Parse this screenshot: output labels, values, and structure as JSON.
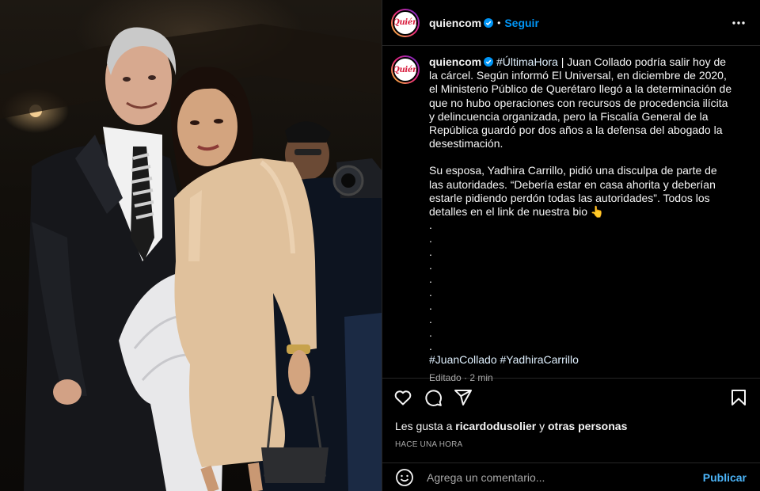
{
  "account": {
    "username": "quiencom",
    "avatar_logo": "Quién",
    "verified": true
  },
  "header": {
    "separator": "•",
    "follow_label": "Seguir",
    "more_icon": "more-horizontal-icon"
  },
  "caption": {
    "username": "quiencom",
    "lead_tag": "#ÚltimaHora",
    "paragraph1": " | Juan Collado podría salir hoy de la cárcel. Según informó El Universal, en diciembre de 2020, el Ministerio Público de Querétaro llegó a la determinación de que no hubo operaciones con recursos de procedencia ilícita y delincuencia organizada, pero la Fiscalía General de la República guardó por dos años a la defensa del abogado la desestimación.",
    "paragraph2": "Su esposa, Yadhira Carrillo, pidió una disculpa de parte de las autoridades. “Debería estar en casa ahorita y deberían estarle pidiendo perdón todas las autoridades”. Todos los detalles en el link de nuestra bio 👆",
    "dots": [
      ".",
      ".",
      ".",
      ".",
      ".",
      ".",
      ".",
      ".",
      ".",
      "."
    ],
    "hashtag1": "#JuanCollado",
    "hashtag2": "#YadhiraCarrillo",
    "edited": "Editado · 2 min"
  },
  "actions": {
    "icons": [
      "heart-icon",
      "comment-icon",
      "share-icon",
      "bookmark-icon"
    ]
  },
  "likes": {
    "prefix": "Les gusta a ",
    "user": "ricardodusolier",
    "middle": " y ",
    "others": "otras personas"
  },
  "timestamp": "HACE UNA HORA",
  "comment": {
    "placeholder": "Agrega un comentario...",
    "publish_label": "Publicar",
    "emoji_icon": "emoji-icon"
  },
  "colors": {
    "background": "#000000",
    "link_blue": "#0095f6",
    "publish_blue": "#4cb5f9",
    "muted": "#a8a8a8",
    "divider": "#262626"
  }
}
